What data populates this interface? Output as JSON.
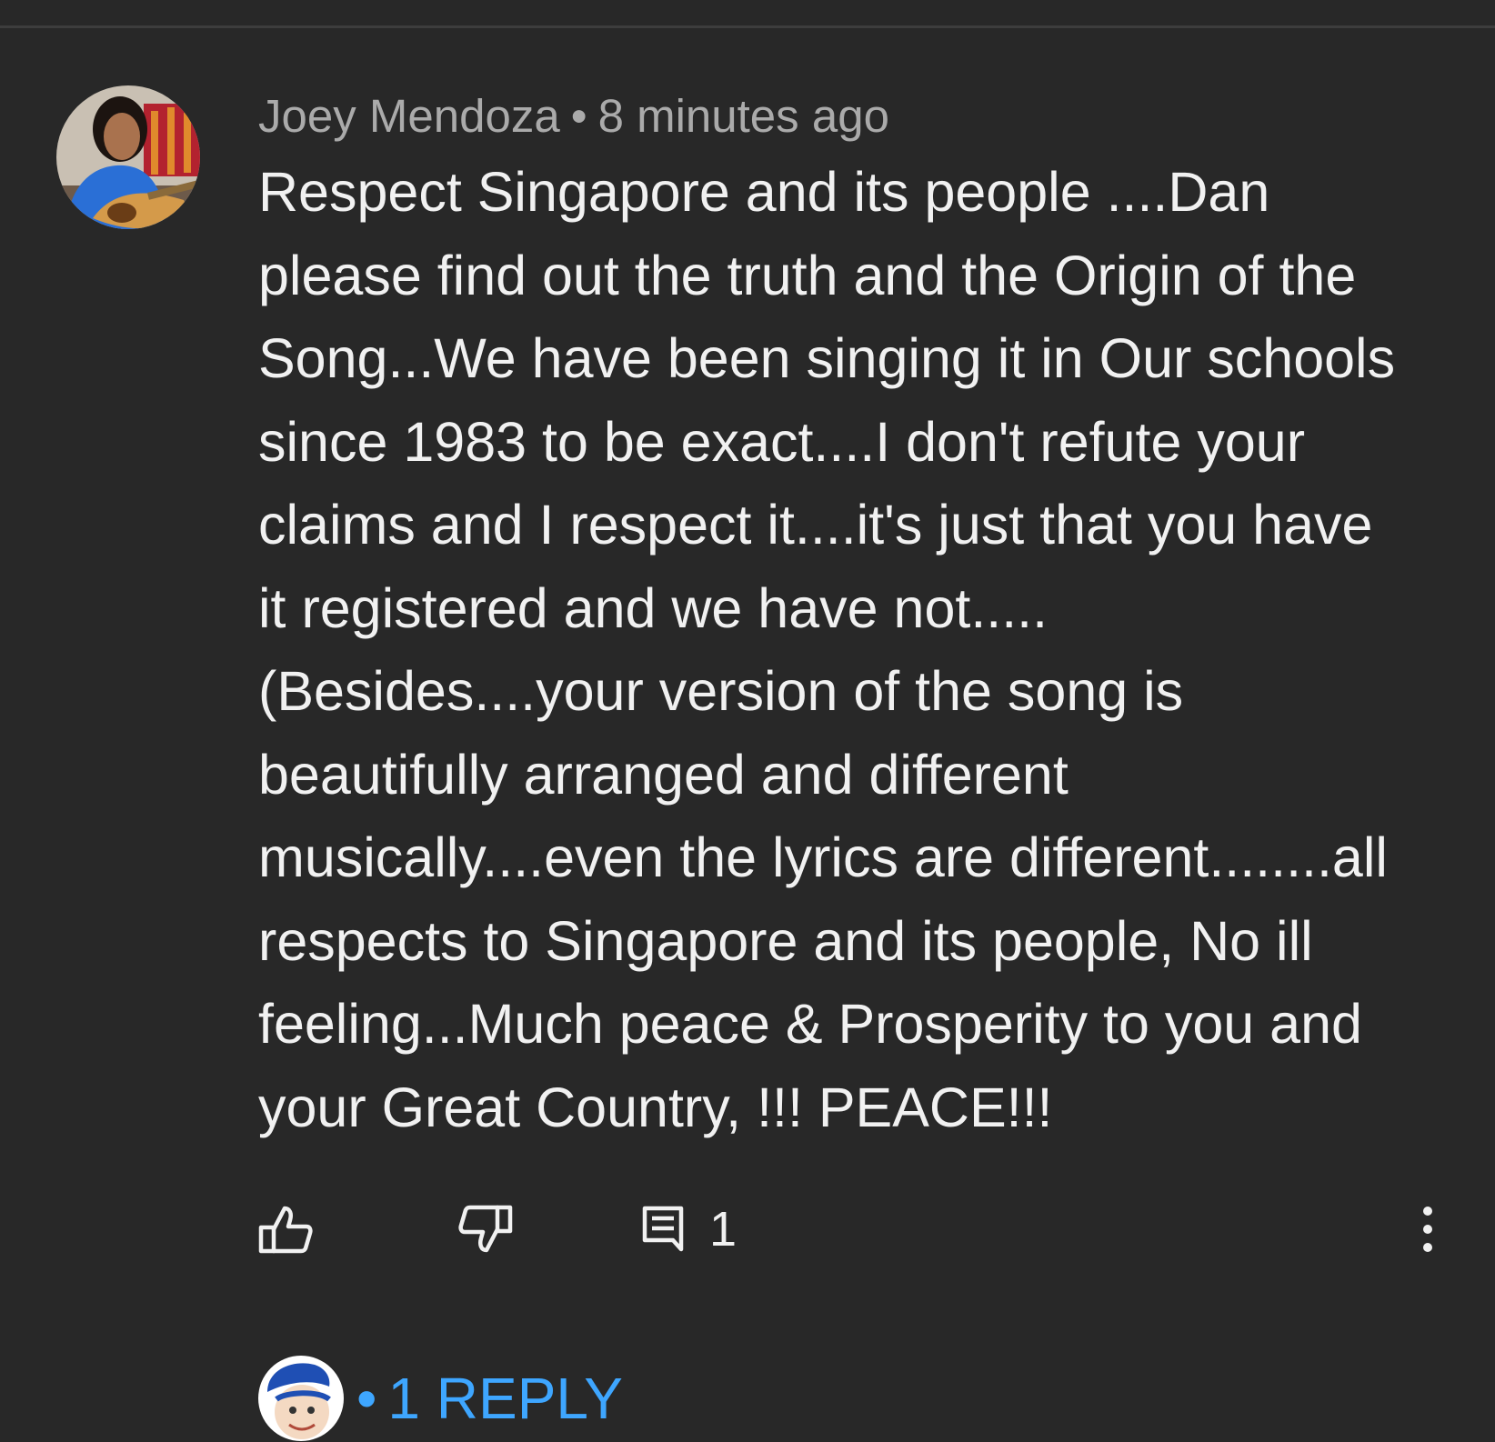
{
  "comment": {
    "author": "Joey Mendoza",
    "separator": "•",
    "timestamp": "8 minutes ago",
    "text_lines": [
      "Respect Singapore and its people ....Dan",
      "please find out the truth and the Origin of the",
      "Song...We have been singing it in Our schools",
      "since 1983 to be exact....I don't refute your",
      "claims and I respect it....it's just that you have",
      "it registered and we have not.....",
      "(Besides....your version of the song is",
      "beautifully arranged and different",
      "musically....even the lyrics are different........all",
      "respects to Singapore and its people, No ill",
      "feeling...Much peace & Prosperity to you and",
      "your Great Country, !!! PEACE!!!"
    ]
  },
  "actions": {
    "like_icon": "thumbs-up-icon",
    "dislike_icon": "thumbs-down-icon",
    "reply_icon": "comment-icon",
    "reply_count": "1",
    "more_icon": "more-vertical-icon"
  },
  "replies": {
    "separator": "•",
    "label": "1 REPLY"
  },
  "colors": {
    "background": "#282828",
    "text_primary": "#f1f1f1",
    "text_secondary": "#aaaaaa",
    "link_blue": "#3ea6ff"
  }
}
